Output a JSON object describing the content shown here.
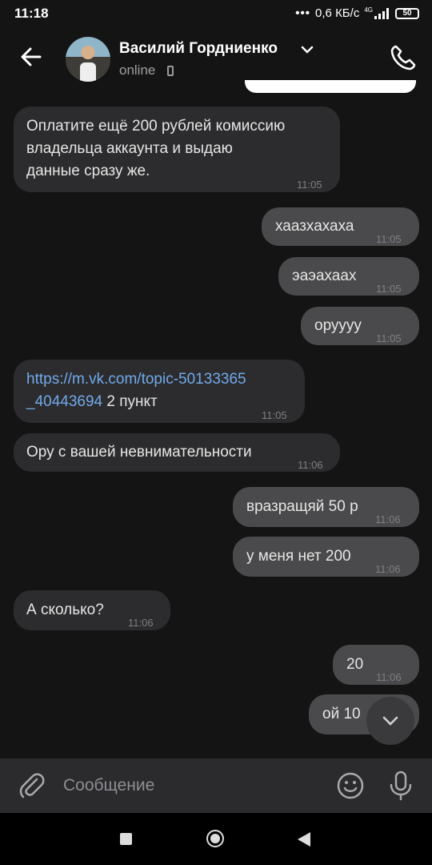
{
  "status_bar": {
    "time": "11:18",
    "network_speed": "0,6 КБ/с",
    "network_type": "4G",
    "battery": "50"
  },
  "header": {
    "contact_name": "Василий Гордниенко",
    "status": "online",
    "back_icon": "arrow-left-icon",
    "call_icon": "phone-icon"
  },
  "messages": [
    {
      "dir": "in",
      "text": "Оплатите ещё 200 рублей комиссию\nвладельца аккаунта и выдаю\nданные сразу же.",
      "time": "11:05"
    },
    {
      "dir": "out",
      "text": "хаазхахаха",
      "time": "11:05"
    },
    {
      "dir": "out",
      "text": "эаэахаах",
      "time": "11:05"
    },
    {
      "dir": "out",
      "text": "оруууу",
      "time": "11:05"
    },
    {
      "dir": "in",
      "link": "https://m.vk.com/topic-50133365\n_40443694",
      "text": " 2 пункт",
      "time": "11:05"
    },
    {
      "dir": "in",
      "text": "Ору с вашей невнимательности",
      "time": "11:06"
    },
    {
      "dir": "out",
      "text": "вразращяй 50 р",
      "time": "11:06"
    },
    {
      "dir": "out",
      "text": "у меня нет 200",
      "time": "11:06"
    },
    {
      "dir": "in",
      "text": "А сколько?",
      "time": "11:06"
    },
    {
      "dir": "out",
      "text": "20",
      "time": "11:06"
    },
    {
      "dir": "out",
      "text": "ой 10",
      "time": ""
    }
  ],
  "composer": {
    "placeholder": "Сообщение"
  },
  "colors": {
    "background": "#141414",
    "incoming": "#2c2c2e",
    "outgoing": "#4a4a4c",
    "link": "#71aaeb"
  }
}
